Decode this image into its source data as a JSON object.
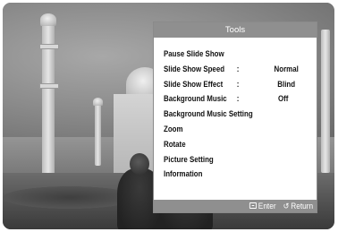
{
  "tools": {
    "title": "Tools",
    "items": [
      {
        "label": "Pause Slide Show"
      },
      {
        "label": "Slide Show Speed",
        "colon": ":",
        "value": "Normal"
      },
      {
        "label": "Slide Show Effect",
        "colon": ":",
        "value": "Blind"
      },
      {
        "label": "Background Music",
        "colon": ":",
        "value": "Off"
      },
      {
        "label": "Background Music Setting"
      },
      {
        "label": "Zoom"
      },
      {
        "label": "Rotate"
      },
      {
        "label": "Picture Setting"
      },
      {
        "label": "Information"
      }
    ],
    "footer": {
      "enter_icon": "enter-icon",
      "enter_label": "Enter",
      "return_icon": "return-icon",
      "return_glyph": "↺",
      "return_label": "Return"
    }
  }
}
